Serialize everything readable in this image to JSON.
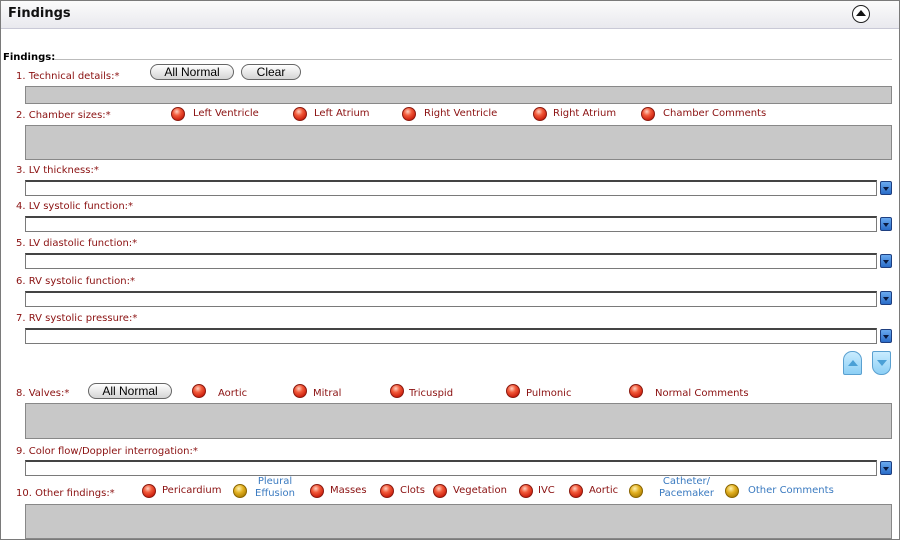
{
  "panel": {
    "title": "Findings"
  },
  "section_heading": "Findings:",
  "technical": {
    "label": "1. Technical details:*",
    "all_normal": "All Normal",
    "clear": "Clear"
  },
  "chamber": {
    "label": "2. Chamber sizes:*",
    "options": [
      {
        "label": "Left Ventricle",
        "color": "red"
      },
      {
        "label": "Left Atrium",
        "color": "red"
      },
      {
        "label": "Right Ventricle",
        "color": "red"
      },
      {
        "label": "Right Atrium",
        "color": "red"
      },
      {
        "label": "Chamber Comments",
        "color": "red"
      }
    ]
  },
  "fields": [
    {
      "label": "3. LV thickness:*"
    },
    {
      "label": "4. LV systolic function:*"
    },
    {
      "label": "5. LV diastolic function:*"
    },
    {
      "label": "6. RV systolic function:*"
    },
    {
      "label": "7. RV systolic pressure:*"
    }
  ],
  "valves": {
    "label": "8. Valves:*",
    "all_normal": "All Normal",
    "options": [
      {
        "label": "Aortic",
        "color": "red"
      },
      {
        "label": "Mitral",
        "color": "red"
      },
      {
        "label": "Tricuspid",
        "color": "red"
      },
      {
        "label": "Pulmonic",
        "color": "red"
      },
      {
        "label": "Normal Comments",
        "color": "red"
      }
    ]
  },
  "color_flow": {
    "label": "9. Color flow/Doppler interrogation:*"
  },
  "other": {
    "label": "10. Other findings:*",
    "options": [
      {
        "label": "Pericardium",
        "color": "red"
      },
      {
        "line1": "Pleural",
        "line2": "Effusion",
        "color": "yellow"
      },
      {
        "label": "Masses",
        "color": "red"
      },
      {
        "label": "Clots",
        "color": "red"
      },
      {
        "label": "Vegetation",
        "color": "red"
      },
      {
        "label": "IVC",
        "color": "red"
      },
      {
        "label": "Aortic",
        "color": "red"
      },
      {
        "line1": "Catheter/",
        "line2": "Pacemaker",
        "color": "yellow"
      },
      {
        "label": "Other Comments",
        "color": "yellow"
      }
    ]
  },
  "colors": {
    "label_red": "#8a1010",
    "link_blue": "#3a7ac0",
    "box_gray": "#c8c8c8"
  }
}
